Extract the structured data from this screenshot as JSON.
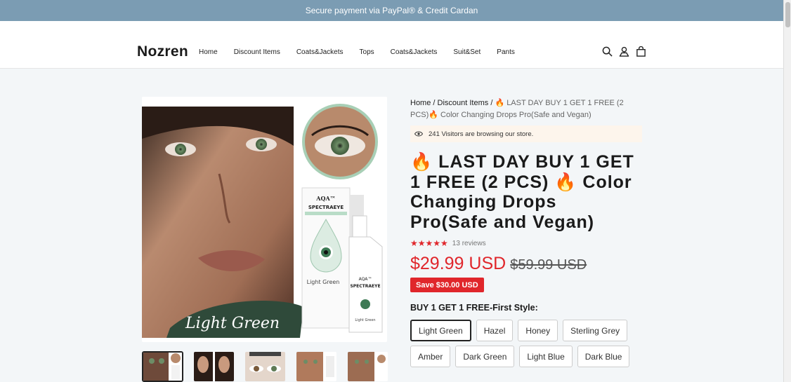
{
  "announcement": "Secure payment via PayPal® & Credit Cardan",
  "header": {
    "logo": "Nozren",
    "nav": [
      "Home",
      "Discount Items",
      "Coats&Jackets",
      "Tops",
      "Coats&Jackets",
      "Suit&Set",
      "Pants"
    ]
  },
  "product": {
    "image_brand": "AQA™ SPECTRAEYE",
    "image_label": "Light Green",
    "image_script": "Light Green",
    "breadcrumb": {
      "home": "Home",
      "sep1": " / ",
      "category": "Discount Items",
      "sep2": " / ",
      "current": "🔥 LAST DAY BUY 1 GET 1 FREE (2 PCS)🔥 Color Changing Drops Pro(Safe and Vegan)"
    },
    "visitors": "241 Visitors are browsing our store.",
    "title": "🔥 LAST DAY BUY 1 GET 1 FREE (2 PCS) 🔥 Color Changing Drops Pro(Safe and Vegan)",
    "stars": "★★★★★",
    "reviews": "13 reviews",
    "price": "$29.99 USD",
    "compare_price": "$59.99 USD",
    "save": "Save $30.00 USD",
    "option_label": "BUY 1 GET 1 FREE-First Style:",
    "options": [
      "Light Green",
      "Hazel",
      "Honey",
      "Sterling Grey",
      "Amber",
      "Dark Green",
      "Light Blue",
      "Dark Blue"
    ],
    "selected_option": "Light Green"
  },
  "colors": {
    "accent": "#e0262b",
    "announce_bg": "#7b9cb3"
  }
}
